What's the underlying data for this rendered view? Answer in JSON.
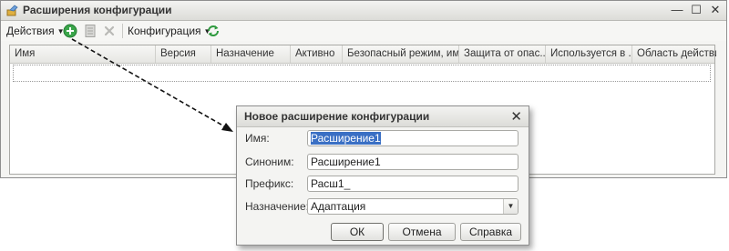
{
  "main_window": {
    "title": "Расширения конфигурации",
    "controls": {
      "minimize": "—",
      "maximize": "☐",
      "close": "✕"
    }
  },
  "toolbar": {
    "actions_label": "Действия",
    "configuration_label": "Конфигурация",
    "icons": [
      "add-circle-icon",
      "document-icon",
      "delete-icon",
      "refresh-icon"
    ],
    "add_color": "#3aa54a"
  },
  "table": {
    "columns": [
      "Имя",
      "Версия",
      "Назначение",
      "Активно",
      "Безопасный режим, им...",
      "Защита от опас...",
      "Используется в ...",
      "Область действия"
    ]
  },
  "dialog": {
    "title": "Новое расширение конфигурации",
    "close": "✕",
    "fields": {
      "name": {
        "label": "Имя:",
        "value": "Расширение1"
      },
      "synonym": {
        "label": "Синоним:",
        "value": "Расширение1"
      },
      "prefix": {
        "label": "Префикс:",
        "value": "Расш1_"
      },
      "purpose": {
        "label": "Назначение:",
        "value": "Адаптация"
      }
    },
    "buttons": {
      "ok": "ОК",
      "cancel": "Отмена",
      "help": "Справка"
    }
  },
  "colors": {
    "selection": "#3a6fc4",
    "frame": "#8e8e8e",
    "background": "#f4f4f2"
  }
}
